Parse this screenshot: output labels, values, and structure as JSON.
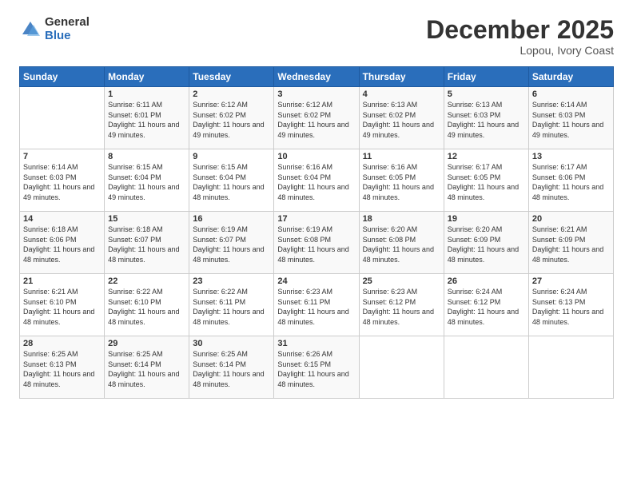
{
  "header": {
    "logo_general": "General",
    "logo_blue": "Blue",
    "month_title": "December 2025",
    "subtitle": "Lopou, Ivory Coast"
  },
  "calendar": {
    "days_of_week": [
      "Sunday",
      "Monday",
      "Tuesday",
      "Wednesday",
      "Thursday",
      "Friday",
      "Saturday"
    ],
    "weeks": [
      [
        {
          "day": "",
          "sunrise": "",
          "sunset": "",
          "daylight": ""
        },
        {
          "day": "1",
          "sunrise": "Sunrise: 6:11 AM",
          "sunset": "Sunset: 6:01 PM",
          "daylight": "Daylight: 11 hours and 49 minutes."
        },
        {
          "day": "2",
          "sunrise": "Sunrise: 6:12 AM",
          "sunset": "Sunset: 6:02 PM",
          "daylight": "Daylight: 11 hours and 49 minutes."
        },
        {
          "day": "3",
          "sunrise": "Sunrise: 6:12 AM",
          "sunset": "Sunset: 6:02 PM",
          "daylight": "Daylight: 11 hours and 49 minutes."
        },
        {
          "day": "4",
          "sunrise": "Sunrise: 6:13 AM",
          "sunset": "Sunset: 6:02 PM",
          "daylight": "Daylight: 11 hours and 49 minutes."
        },
        {
          "day": "5",
          "sunrise": "Sunrise: 6:13 AM",
          "sunset": "Sunset: 6:03 PM",
          "daylight": "Daylight: 11 hours and 49 minutes."
        },
        {
          "day": "6",
          "sunrise": "Sunrise: 6:14 AM",
          "sunset": "Sunset: 6:03 PM",
          "daylight": "Daylight: 11 hours and 49 minutes."
        }
      ],
      [
        {
          "day": "7",
          "sunrise": "Sunrise: 6:14 AM",
          "sunset": "Sunset: 6:03 PM",
          "daylight": "Daylight: 11 hours and 49 minutes."
        },
        {
          "day": "8",
          "sunrise": "Sunrise: 6:15 AM",
          "sunset": "Sunset: 6:04 PM",
          "daylight": "Daylight: 11 hours and 49 minutes."
        },
        {
          "day": "9",
          "sunrise": "Sunrise: 6:15 AM",
          "sunset": "Sunset: 6:04 PM",
          "daylight": "Daylight: 11 hours and 48 minutes."
        },
        {
          "day": "10",
          "sunrise": "Sunrise: 6:16 AM",
          "sunset": "Sunset: 6:04 PM",
          "daylight": "Daylight: 11 hours and 48 minutes."
        },
        {
          "day": "11",
          "sunrise": "Sunrise: 6:16 AM",
          "sunset": "Sunset: 6:05 PM",
          "daylight": "Daylight: 11 hours and 48 minutes."
        },
        {
          "day": "12",
          "sunrise": "Sunrise: 6:17 AM",
          "sunset": "Sunset: 6:05 PM",
          "daylight": "Daylight: 11 hours and 48 minutes."
        },
        {
          "day": "13",
          "sunrise": "Sunrise: 6:17 AM",
          "sunset": "Sunset: 6:06 PM",
          "daylight": "Daylight: 11 hours and 48 minutes."
        }
      ],
      [
        {
          "day": "14",
          "sunrise": "Sunrise: 6:18 AM",
          "sunset": "Sunset: 6:06 PM",
          "daylight": "Daylight: 11 hours and 48 minutes."
        },
        {
          "day": "15",
          "sunrise": "Sunrise: 6:18 AM",
          "sunset": "Sunset: 6:07 PM",
          "daylight": "Daylight: 11 hours and 48 minutes."
        },
        {
          "day": "16",
          "sunrise": "Sunrise: 6:19 AM",
          "sunset": "Sunset: 6:07 PM",
          "daylight": "Daylight: 11 hours and 48 minutes."
        },
        {
          "day": "17",
          "sunrise": "Sunrise: 6:19 AM",
          "sunset": "Sunset: 6:08 PM",
          "daylight": "Daylight: 11 hours and 48 minutes."
        },
        {
          "day": "18",
          "sunrise": "Sunrise: 6:20 AM",
          "sunset": "Sunset: 6:08 PM",
          "daylight": "Daylight: 11 hours and 48 minutes."
        },
        {
          "day": "19",
          "sunrise": "Sunrise: 6:20 AM",
          "sunset": "Sunset: 6:09 PM",
          "daylight": "Daylight: 11 hours and 48 minutes."
        },
        {
          "day": "20",
          "sunrise": "Sunrise: 6:21 AM",
          "sunset": "Sunset: 6:09 PM",
          "daylight": "Daylight: 11 hours and 48 minutes."
        }
      ],
      [
        {
          "day": "21",
          "sunrise": "Sunrise: 6:21 AM",
          "sunset": "Sunset: 6:10 PM",
          "daylight": "Daylight: 11 hours and 48 minutes."
        },
        {
          "day": "22",
          "sunrise": "Sunrise: 6:22 AM",
          "sunset": "Sunset: 6:10 PM",
          "daylight": "Daylight: 11 hours and 48 minutes."
        },
        {
          "day": "23",
          "sunrise": "Sunrise: 6:22 AM",
          "sunset": "Sunset: 6:11 PM",
          "daylight": "Daylight: 11 hours and 48 minutes."
        },
        {
          "day": "24",
          "sunrise": "Sunrise: 6:23 AM",
          "sunset": "Sunset: 6:11 PM",
          "daylight": "Daylight: 11 hours and 48 minutes."
        },
        {
          "day": "25",
          "sunrise": "Sunrise: 6:23 AM",
          "sunset": "Sunset: 6:12 PM",
          "daylight": "Daylight: 11 hours and 48 minutes."
        },
        {
          "day": "26",
          "sunrise": "Sunrise: 6:24 AM",
          "sunset": "Sunset: 6:12 PM",
          "daylight": "Daylight: 11 hours and 48 minutes."
        },
        {
          "day": "27",
          "sunrise": "Sunrise: 6:24 AM",
          "sunset": "Sunset: 6:13 PM",
          "daylight": "Daylight: 11 hours and 48 minutes."
        }
      ],
      [
        {
          "day": "28",
          "sunrise": "Sunrise: 6:25 AM",
          "sunset": "Sunset: 6:13 PM",
          "daylight": "Daylight: 11 hours and 48 minutes."
        },
        {
          "day": "29",
          "sunrise": "Sunrise: 6:25 AM",
          "sunset": "Sunset: 6:14 PM",
          "daylight": "Daylight: 11 hours and 48 minutes."
        },
        {
          "day": "30",
          "sunrise": "Sunrise: 6:25 AM",
          "sunset": "Sunset: 6:14 PM",
          "daylight": "Daylight: 11 hours and 48 minutes."
        },
        {
          "day": "31",
          "sunrise": "Sunrise: 6:26 AM",
          "sunset": "Sunset: 6:15 PM",
          "daylight": "Daylight: 11 hours and 48 minutes."
        },
        {
          "day": "",
          "sunrise": "",
          "sunset": "",
          "daylight": ""
        },
        {
          "day": "",
          "sunrise": "",
          "sunset": "",
          "daylight": ""
        },
        {
          "day": "",
          "sunrise": "",
          "sunset": "",
          "daylight": ""
        }
      ]
    ]
  }
}
